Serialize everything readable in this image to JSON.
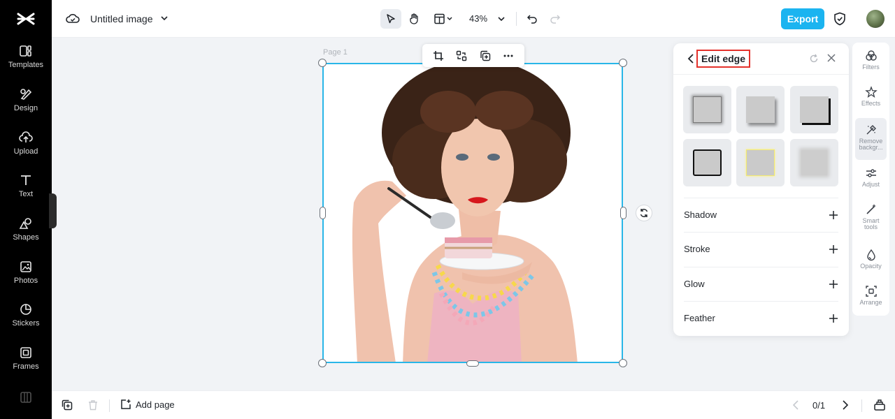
{
  "sidebar": {
    "items": [
      {
        "label": "Templates",
        "icon": "templates-icon"
      },
      {
        "label": "Design",
        "icon": "design-icon"
      },
      {
        "label": "Upload",
        "icon": "upload-icon"
      },
      {
        "label": "Text",
        "icon": "text-icon"
      },
      {
        "label": "Shapes",
        "icon": "shapes-icon"
      },
      {
        "label": "Photos",
        "icon": "photos-icon"
      },
      {
        "label": "Stickers",
        "icon": "stickers-icon"
      },
      {
        "label": "Frames",
        "icon": "frames-icon"
      }
    ]
  },
  "header": {
    "title": "Untitled image",
    "zoom": "43%",
    "export_label": "Export"
  },
  "canvas": {
    "page_label": "Page 1"
  },
  "panel": {
    "title": "Edit edge",
    "options": [
      {
        "label": "Shadow"
      },
      {
        "label": "Stroke"
      },
      {
        "label": "Glow"
      },
      {
        "label": "Feather"
      }
    ]
  },
  "rail": {
    "items": [
      {
        "label": "Filters",
        "icon": "filters-icon"
      },
      {
        "label": "Effects",
        "icon": "effects-icon"
      },
      {
        "label": "Remove backgr...",
        "icon": "remove-background-icon",
        "active": true
      },
      {
        "label": "Adjust",
        "icon": "adjust-icon"
      },
      {
        "label": "Smart tools",
        "icon": "smart-tools-icon"
      },
      {
        "label": "Opacity",
        "icon": "opacity-icon"
      },
      {
        "label": "Arrange",
        "icon": "arrange-icon"
      }
    ]
  },
  "footer": {
    "add_page_label": "Add page",
    "pager": "0/1"
  },
  "colors": {
    "accent": "#1bb4f0",
    "selection": "#29b6e8",
    "highlight": "#e4312b"
  }
}
